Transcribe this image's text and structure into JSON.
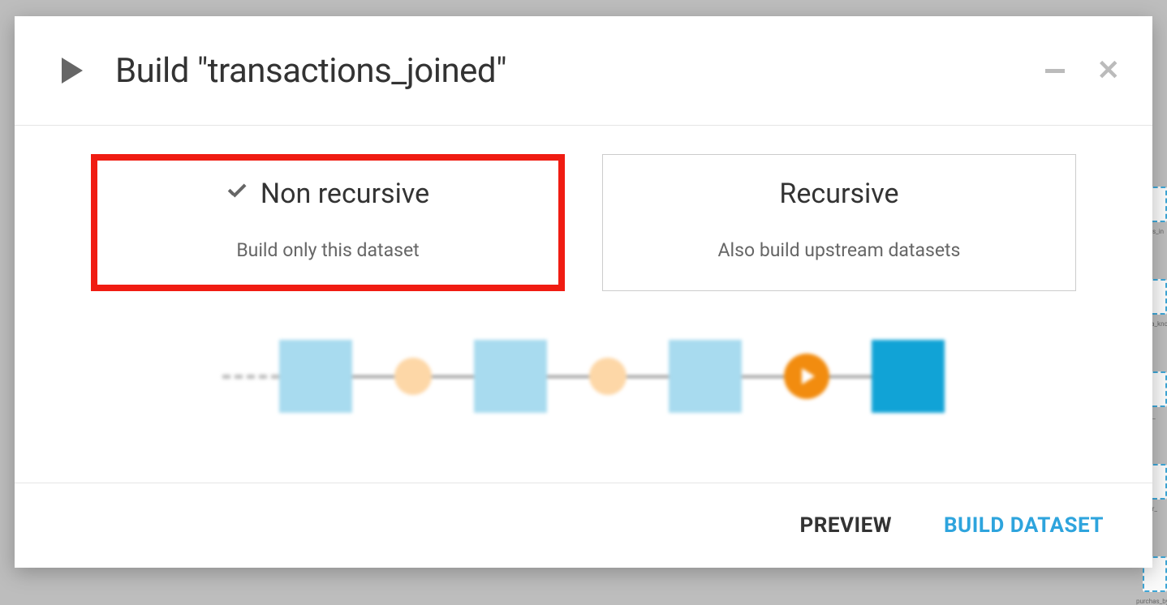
{
  "modal": {
    "title": "Build \"transactions_joined\""
  },
  "options": {
    "non_recursive": {
      "title": "Non recursive",
      "desc": "Build only this dataset",
      "selected": true
    },
    "recursive": {
      "title": "Recursive",
      "desc": "Also build upstream datasets",
      "selected": false
    }
  },
  "footer": {
    "preview_label": "PREVIEW",
    "build_label": "BUILD DATASET"
  },
  "background_nodes": [
    {
      "label": "chants_in"
    },
    {
      "label": "transa_known"
    },
    {
      "label": "purch_"
    },
    {
      "label": "sector_"
    },
    {
      "label": "purchas_by_fir"
    }
  ]
}
